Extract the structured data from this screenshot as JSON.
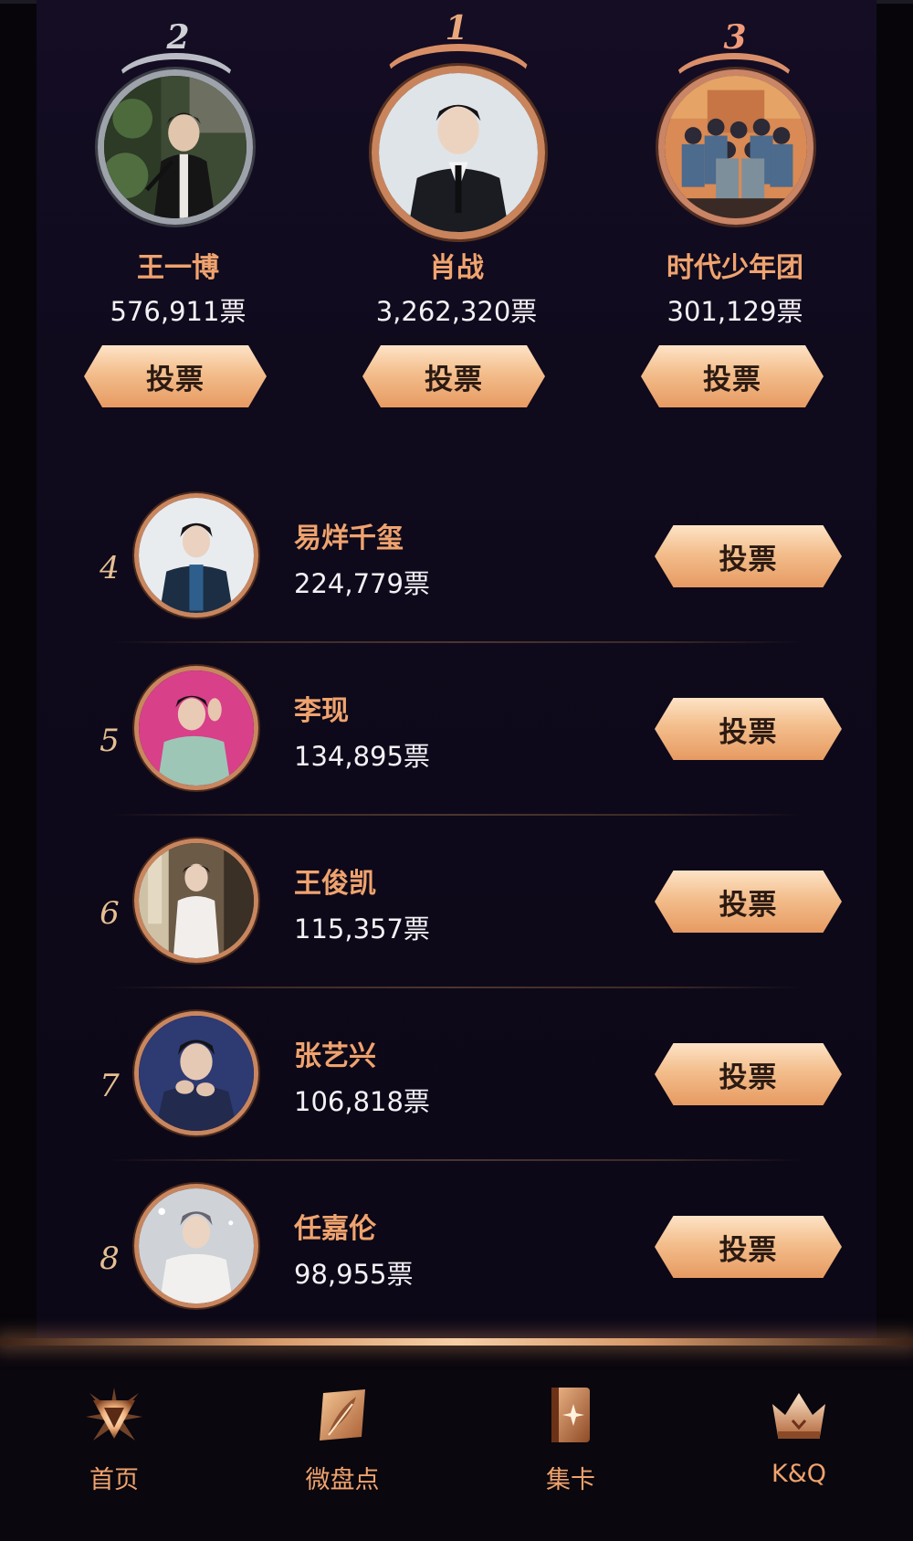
{
  "podium": [
    {
      "rank": "2",
      "name": "王一博",
      "votes": "576,911票",
      "button": "投票"
    },
    {
      "rank": "1",
      "name": "肖战",
      "votes": "3,262,320票",
      "button": "投票"
    },
    {
      "rank": "3",
      "name": "时代少年团",
      "votes": "301,129票",
      "button": "投票"
    }
  ],
  "list": [
    {
      "rank": "4",
      "name": "易烊千玺",
      "votes": "224,779票",
      "button": "投票"
    },
    {
      "rank": "5",
      "name": "李现",
      "votes": "134,895票",
      "button": "投票"
    },
    {
      "rank": "6",
      "name": "王俊凯",
      "votes": "115,357票",
      "button": "投票"
    },
    {
      "rank": "7",
      "name": "张艺兴",
      "votes": "106,818票",
      "button": "投票"
    },
    {
      "rank": "8",
      "name": "任嘉伦",
      "votes": "98,955票",
      "button": "投票"
    }
  ],
  "nav": [
    {
      "label": "首页",
      "icon": "home-emblem-icon"
    },
    {
      "label": "微盘点",
      "icon": "feather-icon"
    },
    {
      "label": "集卡",
      "icon": "card-icon"
    },
    {
      "label": "K&Q",
      "icon": "crown-icon"
    }
  ],
  "colors": {
    "accent": "#f0a36e",
    "button_gradient_top": "#fde3c6",
    "button_gradient_bottom": "#e79a62",
    "background": "#0f0a1c",
    "silver": "#b9bcc4"
  }
}
